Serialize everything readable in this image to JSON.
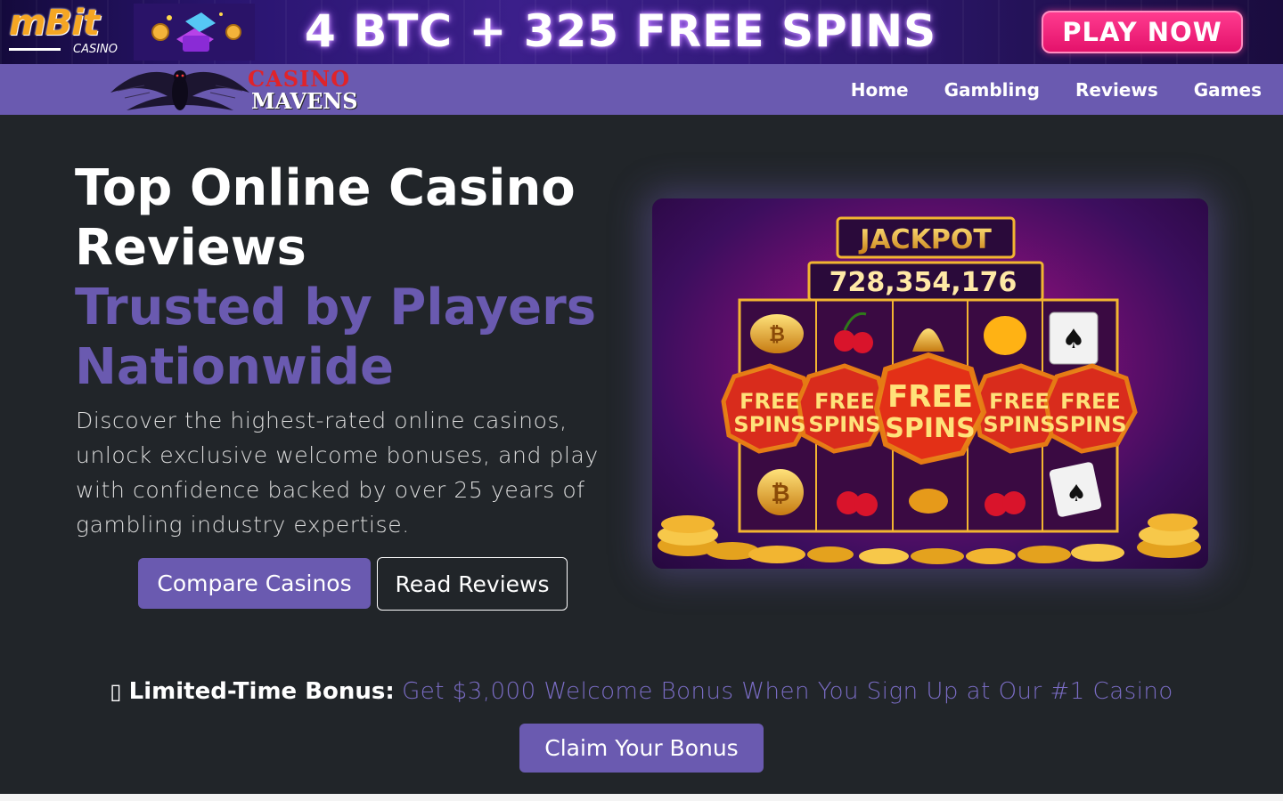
{
  "banner": {
    "brand": "mBit",
    "brand_sub": "CASINO",
    "headline": "4 BTC + 325 FREE SPINS",
    "cta_label": "PLAY NOW"
  },
  "navbar": {
    "logo_line1": "CASINO",
    "logo_line2": "MAVENS",
    "links": [
      {
        "label": "Home"
      },
      {
        "label": "Gambling"
      },
      {
        "label": "Reviews"
      },
      {
        "label": "Games"
      }
    ]
  },
  "hero": {
    "title_line1": "Top Online Casino",
    "title_line2": "Reviews",
    "accent_line1": "Trusted by Players",
    "accent_line2": "Nationwide",
    "description": "Discover the highest-rated online casinos, unlock exclusive welcome bonuses, and play with confidence backed by over 25 years of gambling industry expertise.",
    "primary_button": "Compare Casinos",
    "secondary_button": "Read Reviews",
    "image": {
      "jackpot_label": "JACKPOT",
      "jackpot_value": "728,354,176",
      "free_spins": "FREE SPINS"
    }
  },
  "bonus": {
    "icon": "gift-icon",
    "icon_glyph": "▯",
    "label": "Limited-Time Bonus:",
    "text": "Get $3,000 Welcome Bonus When You Sign Up at Our #1 Casino",
    "button": "Claim Your Bonus"
  },
  "colors": {
    "accent": "#6a5ab0",
    "background": "#212529",
    "cta_pink": "#e4126b"
  }
}
